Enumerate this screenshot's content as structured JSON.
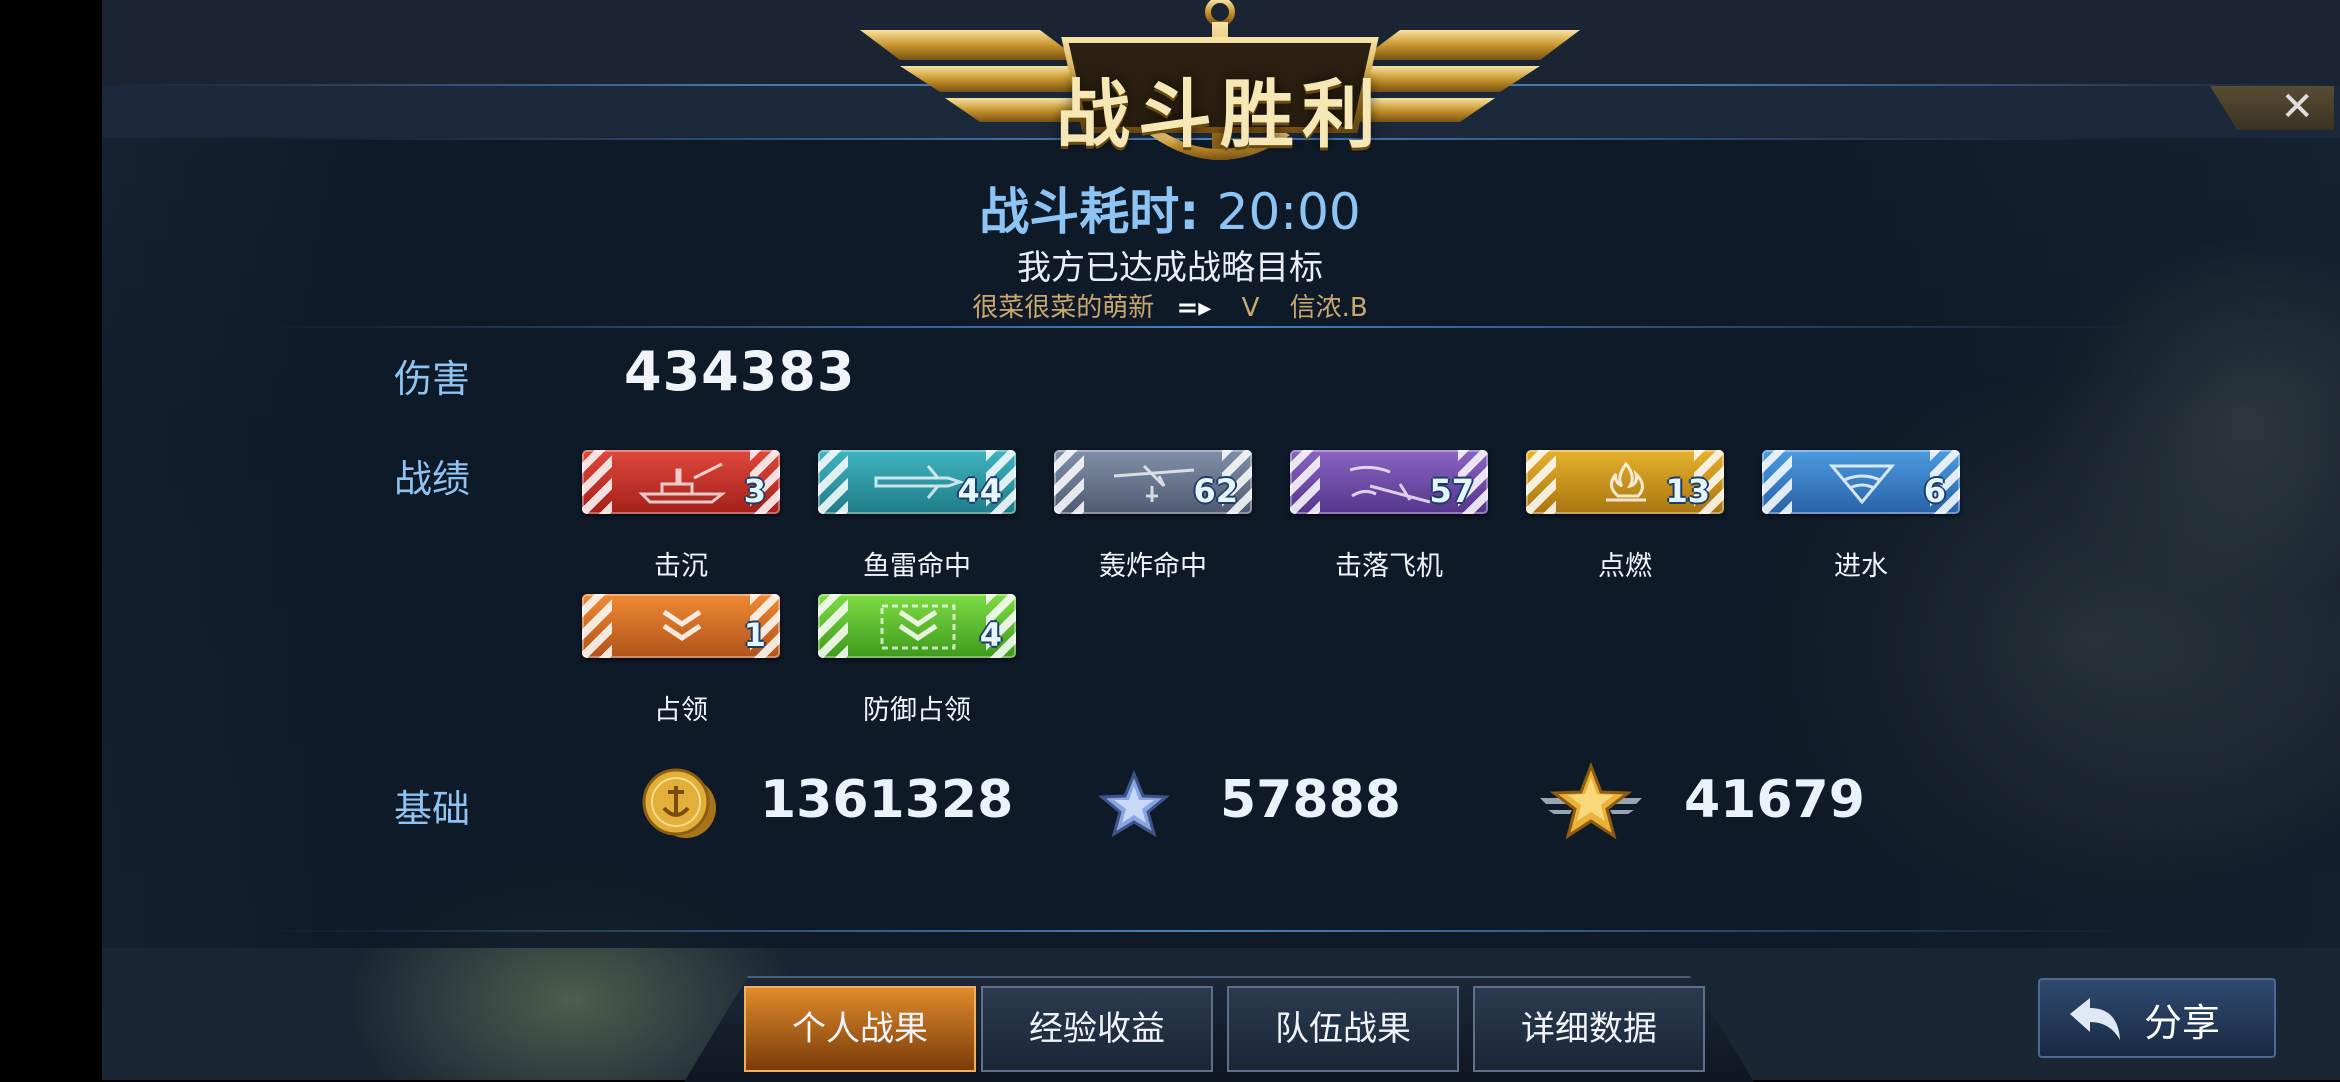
{
  "header": {
    "title": "战斗胜利",
    "duration_label": "战斗耗时:",
    "duration_value": "20:00",
    "objective": "我方已达成战略目标",
    "matchup": {
      "left": "很菜很菜的萌新",
      "vs": "V",
      "right": "信浓.B"
    }
  },
  "damage": {
    "label": "伤害",
    "value": "434383"
  },
  "records": {
    "label": "战绩",
    "items": [
      {
        "name": "击沉",
        "count": "3",
        "color": "#d83a30",
        "icon": "ship-icon"
      },
      {
        "name": "鱼雷命中",
        "count": "44",
        "color": "#2fa0ac",
        "icon": "torpedo-icon"
      },
      {
        "name": "轰炸命中",
        "count": "62",
        "color": "#6a7890",
        "icon": "bomber-icon"
      },
      {
        "name": "击落飞机",
        "count": "57",
        "color": "#7450ac",
        "icon": "plane-down-icon"
      },
      {
        "name": "点燃",
        "count": "13",
        "color": "#d09a20",
        "icon": "fire-icon"
      },
      {
        "name": "进水",
        "count": "6",
        "color": "#3a84cc",
        "icon": "flood-icon"
      },
      {
        "name": "占领",
        "count": "1",
        "color": "#e07428",
        "icon": "capture-icon"
      },
      {
        "name": "防御占领",
        "count": "4",
        "color": "#5cc030",
        "icon": "defend-capture-icon"
      }
    ]
  },
  "basic": {
    "label": "基础",
    "coins": "1361328",
    "stars": "57888",
    "exp": "41679"
  },
  "tabs": [
    "个人战果",
    "经验收益",
    "队伍战果",
    "详细数据"
  ],
  "active_tab": 0,
  "share_label": "分享",
  "close_icon": "close-icon"
}
